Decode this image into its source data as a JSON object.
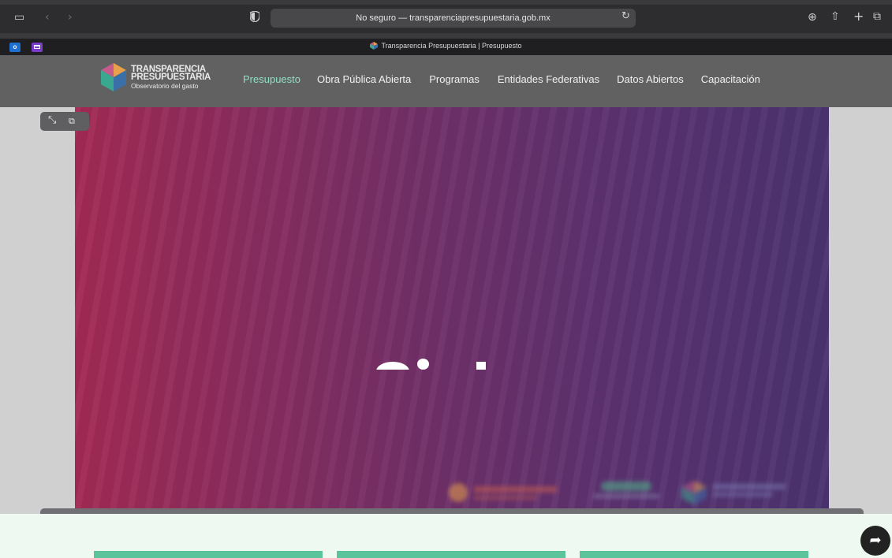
{
  "browser": {
    "address": "No seguro — transparenciapresupuestaria.gob.mx",
    "tab_title": "Transparencia Presupuestaria | Presupuesto",
    "icons": [
      "sidebar-icon",
      "back-icon",
      "forward-icon",
      "shield-icon",
      "reload-icon",
      "download-icon",
      "share-icon",
      "new-tab-icon",
      "tabs-overview-icon"
    ]
  },
  "extensions": {
    "outlook_label": "o"
  },
  "site": {
    "logo_line1": "TRANSPARENCIA",
    "logo_line2": "PRESUPUESTARIA",
    "logo_line3": "Observatorio del gasto",
    "nav": [
      {
        "label": "Presupuesto",
        "active": true
      },
      {
        "label": "Obra Pública Abierta",
        "active": false
      },
      {
        "label": "Programas",
        "active": false
      },
      {
        "label": "Entidades Federativas",
        "active": false
      },
      {
        "label": "Datos Abiertos",
        "active": false
      },
      {
        "label": "Capacitación",
        "active": false
      }
    ]
  },
  "colors": {
    "nav_active": "#8fe0c7",
    "card_green": "#5cc49a",
    "video_gradient_start": "#a32a54",
    "video_gradient_end": "#4a3370"
  }
}
